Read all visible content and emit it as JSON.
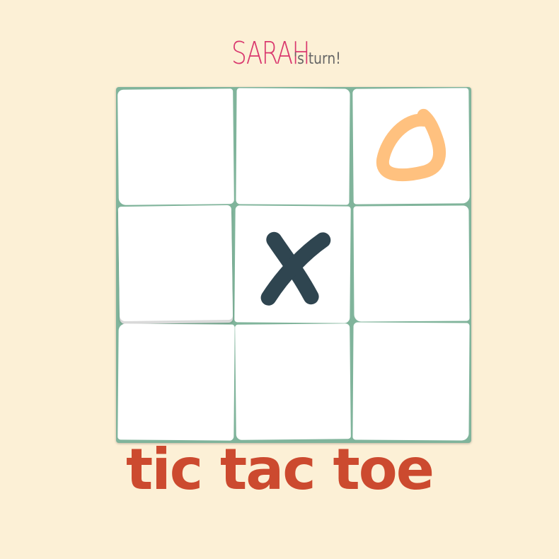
{
  "turn": {
    "player_name": "SARAH",
    "suffix": "'s turn!"
  },
  "board": {
    "cells": [
      "",
      "",
      "O",
      "",
      "X",
      "",
      "",
      "",
      ""
    ]
  },
  "colors": {
    "background": "#fcf0d6",
    "board": "#80b49b",
    "x_mark": "#2f4550",
    "o_mark": "#ffc17f",
    "player_name": "#d9376e",
    "title": "#cc4a2f"
  },
  "title": "tic tac toe"
}
